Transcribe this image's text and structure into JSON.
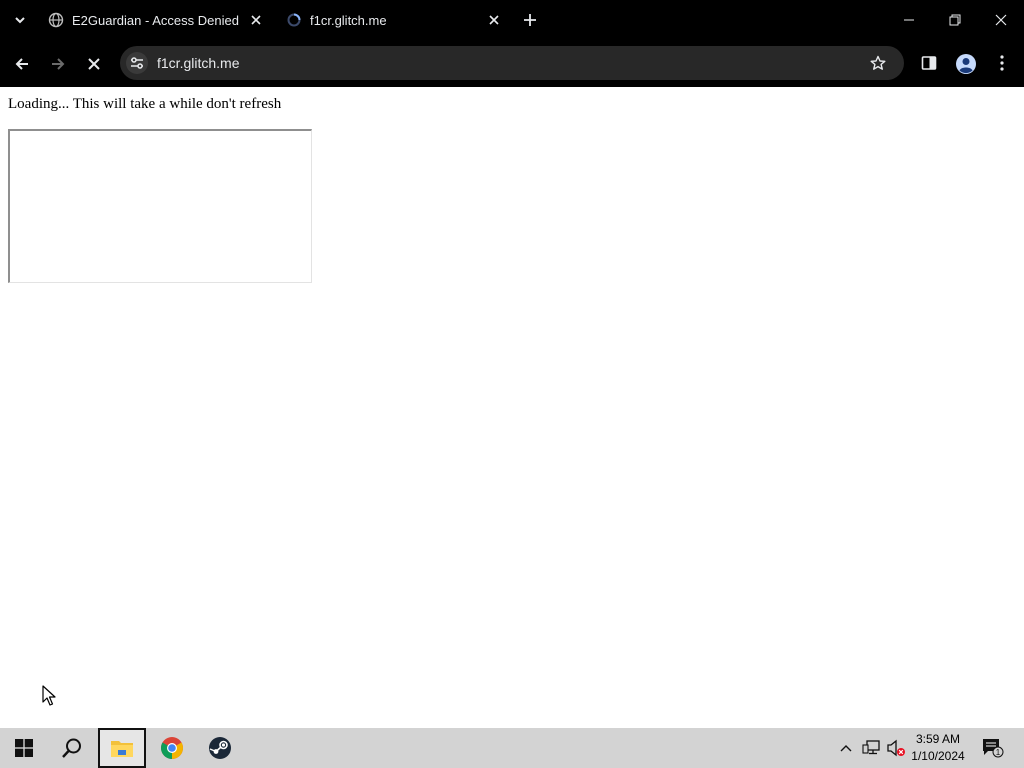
{
  "browser": {
    "tabs": [
      {
        "title": "E2Guardian - Access Denied",
        "favicon": "globe-icon"
      },
      {
        "title": "f1cr.glitch.me",
        "favicon": "loading-spinner-icon"
      }
    ],
    "address": "f1cr.glitch.me",
    "icons": {
      "tab_search": "chevron-down-icon",
      "new_tab": "plus-icon",
      "back": "arrow-left-icon",
      "forward": "arrow-right-icon",
      "stop": "close-icon",
      "site_info": "tune-icon",
      "bookmark": "star-icon",
      "side_panel": "side-panel-icon",
      "profile": "avatar-icon",
      "menu": "kebab-menu-icon"
    }
  },
  "page": {
    "loading_text": "Loading... This will take a while don't refresh"
  },
  "taskbar": {
    "apps": [
      "file-explorer",
      "chrome",
      "steam"
    ],
    "clock_time": "3:59 AM",
    "clock_date": "1/10/2024",
    "notification_count": "1"
  },
  "colors": {
    "chrome_bg": "#000000",
    "omnibox_bg": "#282828",
    "taskbar_bg": "#d3d3d3",
    "text_light": "#e8eaed"
  }
}
